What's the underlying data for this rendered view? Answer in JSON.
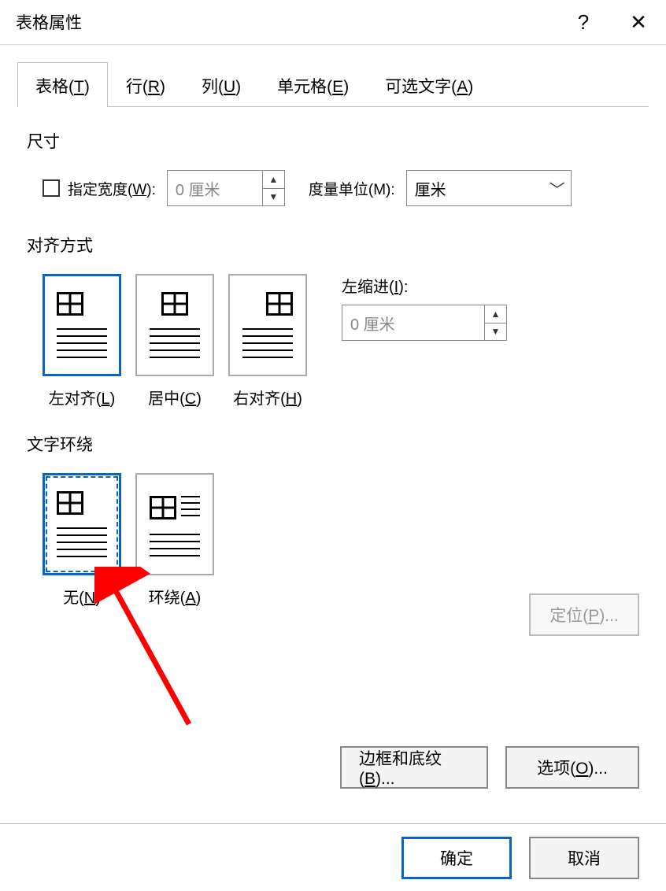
{
  "window": {
    "title": "表格属性",
    "help": "?",
    "close": "✕"
  },
  "tabs": {
    "table": "表格(T)",
    "row": "行(R)",
    "column": "列(U)",
    "cell": "单元格(E)",
    "alttext": "可选文字(A)"
  },
  "size": {
    "group": "尺寸",
    "specify_width": "指定宽度(W):",
    "width_value": "0 厘米",
    "unit_label": "度量单位(M):",
    "unit_value": "厘米"
  },
  "align": {
    "group": "对齐方式",
    "left": "左对齐(L)",
    "center": "居中(C)",
    "right": "右对齐(H)",
    "indent_label": "左缩进(I):",
    "indent_value": "0 厘米"
  },
  "wrap": {
    "group": "文字环绕",
    "none": "无(N)",
    "around": "环绕(A)"
  },
  "buttons": {
    "positioning": "定位(P)...",
    "borders": "边框和底纹(B)...",
    "options": "选项(O)...",
    "ok": "确定",
    "cancel": "取消"
  }
}
